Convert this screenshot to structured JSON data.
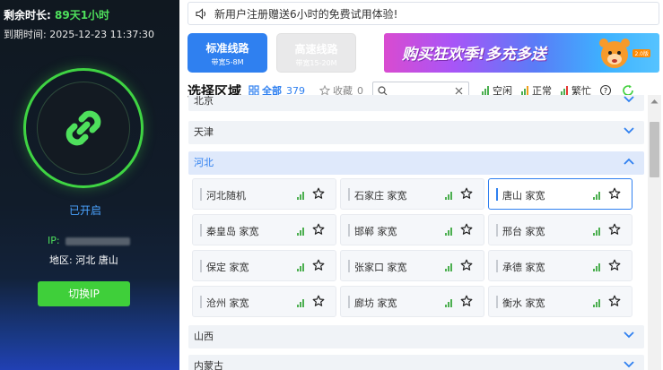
{
  "account": {
    "remain_label": "剩余时长:",
    "remain_value": "89天1小时",
    "expire_label": "到期时间:",
    "expire_value": "2025-12-23 11:37:30"
  },
  "connection": {
    "status": "已开启",
    "ip_label": "IP:",
    "region_label": "地区:",
    "region_value": "河北 唐山",
    "switch_button": "切换IP"
  },
  "notice": "新用户注册赠送6小时的免费试用体验!",
  "lines": [
    {
      "title": "标准线路",
      "sub": "带宽5-8M"
    },
    {
      "title": "高速线路",
      "sub": "带宽15-20M"
    }
  ],
  "banner": {
    "text": "购买狂欢季!多充多送",
    "tag": "2.0版"
  },
  "select": {
    "title": "选择区域",
    "all_label": "全部",
    "all_count": "379",
    "fav_label": "收藏",
    "fav_count": "0",
    "search_placeholder": "",
    "legend": [
      "空闲",
      "正常",
      "繁忙"
    ],
    "help": "?"
  },
  "colors": {
    "idle": "#4caf50",
    "normal": "#f0a020",
    "busy": "#e53935",
    "accent": "#2f80f0"
  },
  "provinces": {
    "beijing": "北京",
    "tianjin": "天津",
    "hebei": "河北",
    "shanxi": "山西",
    "neimenggu": "内蒙古"
  },
  "cities": [
    "河北随机",
    "石家庄 家宽",
    "唐山 家宽",
    "秦皇岛 家宽",
    "邯郸 家宽",
    "邢台 家宽",
    "保定 家宽",
    "张家口 家宽",
    "承德 家宽",
    "沧州 家宽",
    "廊坊 家宽",
    "衡水 家宽"
  ]
}
